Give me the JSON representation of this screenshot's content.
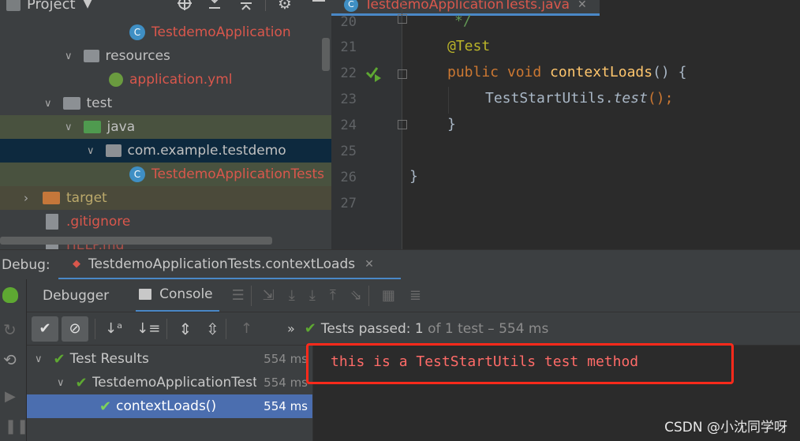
{
  "project_panel": {
    "title": "Project",
    "tree": [
      {
        "label": "TestdemoApplication"
      },
      {
        "label": "resources"
      },
      {
        "label": "application.yml"
      },
      {
        "label": "test"
      },
      {
        "label": "java"
      },
      {
        "label": "com.example.testdemo"
      },
      {
        "label": "TestdemoApplicationTests"
      },
      {
        "label": "target"
      },
      {
        "label": ".gitignore"
      },
      {
        "label": "HELP.md"
      }
    ]
  },
  "editor": {
    "tab_title": "TestdemoApplicationTests.java",
    "lines": [
      {
        "num": "20",
        "text": "*/"
      },
      {
        "num": "21",
        "text": "@Test"
      },
      {
        "num": "22",
        "kw": "public void ",
        "fn": "contextLoads",
        "rest": "() {"
      },
      {
        "num": "23",
        "cls": "TestStartUtils.",
        "method": "test",
        "rest": "();"
      },
      {
        "num": "24",
        "text": "}"
      },
      {
        "num": "25",
        "text": ""
      },
      {
        "num": "26",
        "text": "}"
      },
      {
        "num": "27",
        "text": ""
      }
    ]
  },
  "debug": {
    "label": "Debug:",
    "session_tab": "TestdemoApplicationTests.contextLoads",
    "tabs": {
      "debugger": "Debugger",
      "console": "Console"
    },
    "status": {
      "prefix": "Tests passed: ",
      "passed": "1",
      "suffix": " of 1 test – 554 ms"
    },
    "results": [
      {
        "label": "Test Results",
        "time": "554 ms"
      },
      {
        "label": "TestdemoApplicationTests",
        "time": "554 ms"
      },
      {
        "label": "contextLoads()",
        "time": "554 ms"
      }
    ],
    "console_output": "this is a TestStartUtils test method"
  },
  "watermark": "CSDN @小沈同学呀",
  "colors": {
    "accent_blue": "#4b6eaf",
    "pass_green": "#5ea832",
    "console_red": "#ff6b68",
    "annotation_box": "#ff2a1b"
  }
}
